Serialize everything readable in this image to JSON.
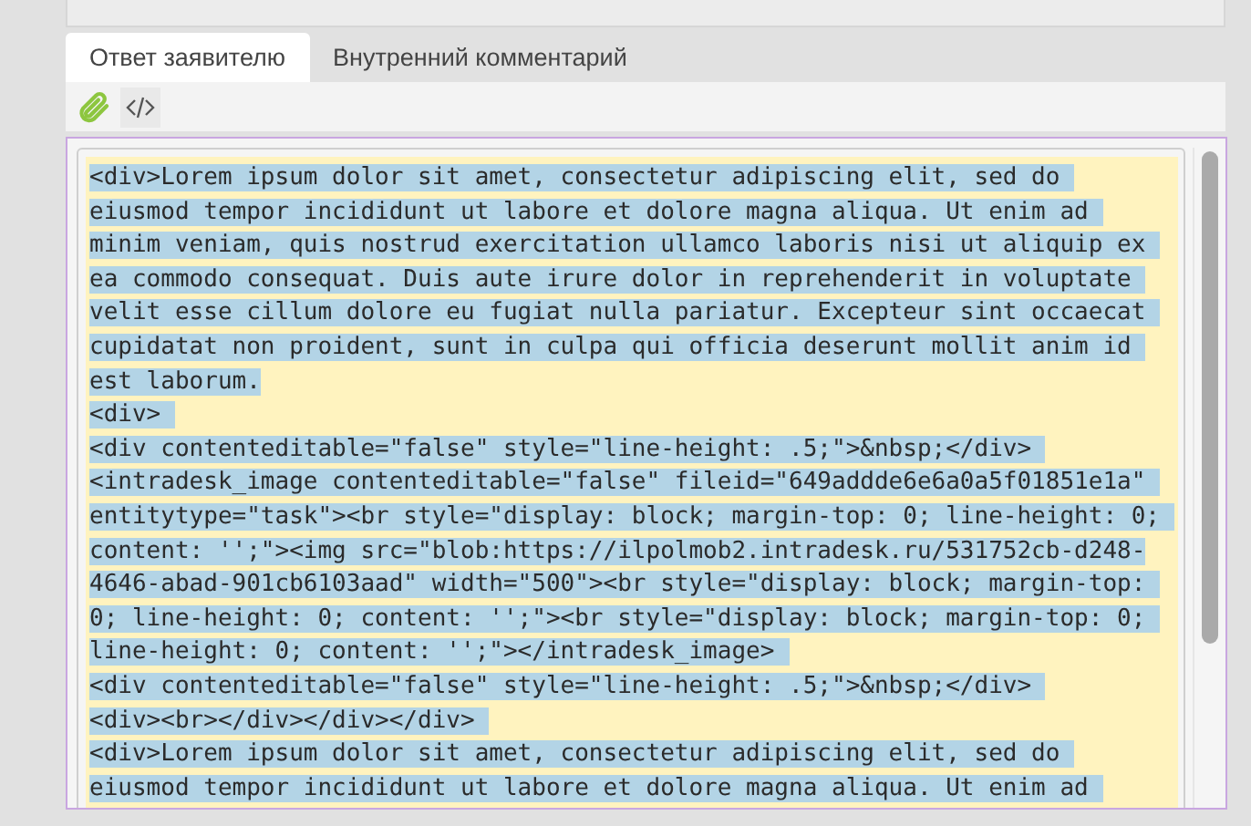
{
  "tabs": [
    {
      "label": "Ответ заявителю",
      "selected": true
    },
    {
      "label": "Внутренний комментарий",
      "selected": false
    }
  ],
  "editor": {
    "lines": [
      "<div>Lorem ipsum dolor sit amet, consectetur adipiscing elit, sed do ",
      "eiusmod tempor incididunt ut labore et dolore magna aliqua. Ut enim ad ",
      "minim veniam, quis nostrud exercitation ullamco laboris nisi ut aliquip ex ",
      "ea commodo consequat. Duis aute irure dolor in reprehenderit in voluptate ",
      "velit esse cillum dolore eu fugiat nulla pariatur. Excepteur sint occaecat ",
      "cupidatat non proident, sunt in culpa qui officia deserunt mollit anim id ",
      "est laborum.",
      "<div> ",
      "<div contenteditable=\"false\" style=\"line-height: .5;\">&nbsp;</div> ",
      "<intradesk_image contenteditable=\"false\" fileid=\"649addde6e6a0a5f01851e1a\" ",
      "entitytype=\"task\"><br style=\"display: block; margin-top: 0; line-height: 0; ",
      "content: '';\"><img src=\"blob:https://ilpolmob2.intradesk.ru/531752cb-d248-",
      "4646-abad-901cb6103aad\" width=\"500\"><br style=\"display: block; margin-top: ",
      "0; line-height: 0; content: '';\"><br style=\"display: block; margin-top: 0; ",
      "line-height: 0; content: '';\"></intradesk_image> ",
      "<div contenteditable=\"false\" style=\"line-height: .5;\">&nbsp;</div> ",
      "<div><br></div></div></div> ",
      "<div>Lorem ipsum dolor sit amet, consectetur adipiscing elit, sed do ",
      "eiusmod tempor incididunt ut labore et dolore magna aliqua. Ut enim ad "
    ]
  }
}
